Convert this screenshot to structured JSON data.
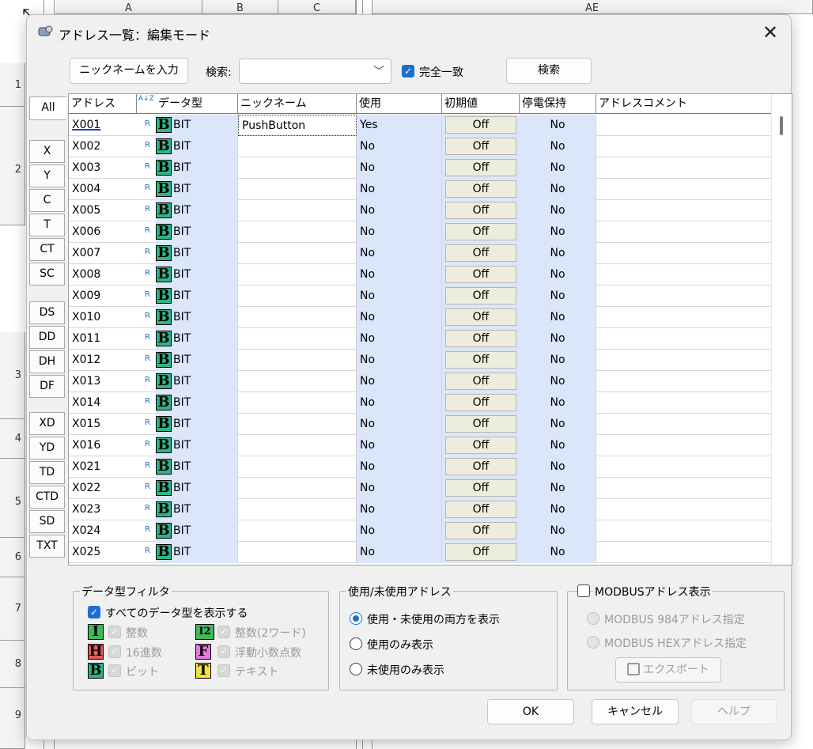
{
  "background": {
    "columns": [
      "A",
      "B",
      "C",
      "AE"
    ],
    "rows": [
      "1",
      "2",
      "3",
      "4",
      "5",
      "6",
      "7",
      "8",
      "9"
    ]
  },
  "dialog": {
    "title": "アドレス一覧：編集モード",
    "close_glyph": "✕"
  },
  "toolbar": {
    "nickname_button": "ニックネームを入力",
    "search_label": "検索:",
    "search_value": "",
    "exact_match_label": "完全一致",
    "exact_match_checked": true,
    "search_button": "検索"
  },
  "filter_tabs": [
    "All",
    "X",
    "Y",
    "C",
    "T",
    "CT",
    "SC",
    "DS",
    "DD",
    "DH",
    "DF",
    "XD",
    "YD",
    "TD",
    "CTD",
    "SD",
    "TXT"
  ],
  "table": {
    "headers": {
      "address": "アドレス",
      "sort_icon": "A↓Z",
      "data_type": "データ型",
      "nickname": "ニックネーム",
      "used": "使用",
      "initial": "初期値",
      "retentive": "停電保持",
      "comment": "アドレスコメント"
    },
    "rows": [
      {
        "address": "X001",
        "r": "R",
        "type_icon": "B",
        "type": "BIT",
        "nickname": "PushButton",
        "used": "Yes",
        "initial": "Off",
        "retentive": "No",
        "comment": ""
      },
      {
        "address": "X002",
        "r": "R",
        "type_icon": "B",
        "type": "BIT",
        "nickname": "",
        "used": "No",
        "initial": "Off",
        "retentive": "No",
        "comment": ""
      },
      {
        "address": "X003",
        "r": "R",
        "type_icon": "B",
        "type": "BIT",
        "nickname": "",
        "used": "No",
        "initial": "Off",
        "retentive": "No",
        "comment": ""
      },
      {
        "address": "X004",
        "r": "R",
        "type_icon": "B",
        "type": "BIT",
        "nickname": "",
        "used": "No",
        "initial": "Off",
        "retentive": "No",
        "comment": ""
      },
      {
        "address": "X005",
        "r": "R",
        "type_icon": "B",
        "type": "BIT",
        "nickname": "",
        "used": "No",
        "initial": "Off",
        "retentive": "No",
        "comment": ""
      },
      {
        "address": "X006",
        "r": "R",
        "type_icon": "B",
        "type": "BIT",
        "nickname": "",
        "used": "No",
        "initial": "Off",
        "retentive": "No",
        "comment": ""
      },
      {
        "address": "X007",
        "r": "R",
        "type_icon": "B",
        "type": "BIT",
        "nickname": "",
        "used": "No",
        "initial": "Off",
        "retentive": "No",
        "comment": ""
      },
      {
        "address": "X008",
        "r": "R",
        "type_icon": "B",
        "type": "BIT",
        "nickname": "",
        "used": "No",
        "initial": "Off",
        "retentive": "No",
        "comment": ""
      },
      {
        "address": "X009",
        "r": "R",
        "type_icon": "B",
        "type": "BIT",
        "nickname": "",
        "used": "No",
        "initial": "Off",
        "retentive": "No",
        "comment": ""
      },
      {
        "address": "X010",
        "r": "R",
        "type_icon": "B",
        "type": "BIT",
        "nickname": "",
        "used": "No",
        "initial": "Off",
        "retentive": "No",
        "comment": ""
      },
      {
        "address": "X011",
        "r": "R",
        "type_icon": "B",
        "type": "BIT",
        "nickname": "",
        "used": "No",
        "initial": "Off",
        "retentive": "No",
        "comment": ""
      },
      {
        "address": "X012",
        "r": "R",
        "type_icon": "B",
        "type": "BIT",
        "nickname": "",
        "used": "No",
        "initial": "Off",
        "retentive": "No",
        "comment": ""
      },
      {
        "address": "X013",
        "r": "R",
        "type_icon": "B",
        "type": "BIT",
        "nickname": "",
        "used": "No",
        "initial": "Off",
        "retentive": "No",
        "comment": ""
      },
      {
        "address": "X014",
        "r": "R",
        "type_icon": "B",
        "type": "BIT",
        "nickname": "",
        "used": "No",
        "initial": "Off",
        "retentive": "No",
        "comment": ""
      },
      {
        "address": "X015",
        "r": "R",
        "type_icon": "B",
        "type": "BIT",
        "nickname": "",
        "used": "No",
        "initial": "Off",
        "retentive": "No",
        "comment": ""
      },
      {
        "address": "X016",
        "r": "R",
        "type_icon": "B",
        "type": "BIT",
        "nickname": "",
        "used": "No",
        "initial": "Off",
        "retentive": "No",
        "comment": ""
      },
      {
        "address": "X021",
        "r": "R",
        "type_icon": "B",
        "type": "BIT",
        "nickname": "",
        "used": "No",
        "initial": "Off",
        "retentive": "No",
        "comment": ""
      },
      {
        "address": "X022",
        "r": "R",
        "type_icon": "B",
        "type": "BIT",
        "nickname": "",
        "used": "No",
        "initial": "Off",
        "retentive": "No",
        "comment": ""
      },
      {
        "address": "X023",
        "r": "R",
        "type_icon": "B",
        "type": "BIT",
        "nickname": "",
        "used": "No",
        "initial": "Off",
        "retentive": "No",
        "comment": ""
      },
      {
        "address": "X024",
        "r": "R",
        "type_icon": "B",
        "type": "BIT",
        "nickname": "",
        "used": "No",
        "initial": "Off",
        "retentive": "No",
        "comment": ""
      },
      {
        "address": "X025",
        "r": "R",
        "type_icon": "B",
        "type": "BIT",
        "nickname": "",
        "used": "No",
        "initial": "Off",
        "retentive": "No",
        "comment": ""
      }
    ]
  },
  "data_type_filter": {
    "legend": "データ型フィルタ",
    "show_all_label": "すべてのデータ型を表示する",
    "show_all_checked": true,
    "types": [
      {
        "icon": "I",
        "label": "整数",
        "color": "#3dbb5c"
      },
      {
        "icon": "I2",
        "label": "整数(2ワード)",
        "color": "#3dbb5c"
      },
      {
        "icon": "H",
        "label": "16進数",
        "color": "#e05a5a"
      },
      {
        "icon": "F",
        "label": "浮動小数点数",
        "color": "#e07adf"
      },
      {
        "icon": "B",
        "label": "ビット",
        "color": "#2bb58a"
      },
      {
        "icon": "T",
        "label": "テキスト",
        "color": "#f0e23a"
      }
    ]
  },
  "usage_filter": {
    "legend": "使用/未使用アドレス",
    "options": [
      "使用・未使用の両方を表示",
      "使用のみ表示",
      "未使用のみ表示"
    ],
    "selected": 0
  },
  "modbus": {
    "legend": "MODBUSアドレス表示",
    "checked": false,
    "options": [
      "MODBUS 984アドレス指定",
      "MODBUS HEXアドレス指定"
    ],
    "export_button": "エクスポート"
  },
  "footer": {
    "ok": "OK",
    "cancel": "キャンセル",
    "help": "ヘルプ"
  },
  "colors": {
    "accent": "#1a6fd0",
    "type_column_bg": "#dbe6fb",
    "off_button_bg": "#ededde"
  }
}
